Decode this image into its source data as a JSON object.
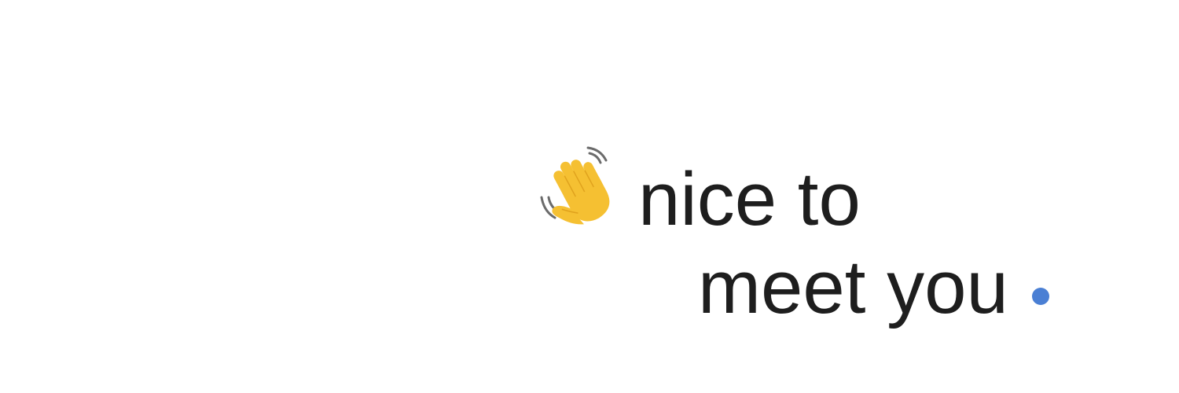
{
  "greeting": {
    "icon": "waving-hand-icon",
    "line1": "nice to",
    "line2": "meet you"
  },
  "colors": {
    "text": "#1e1e1e",
    "accent": "#4a7fd4",
    "hand": "#f5c032",
    "hand_shadow": "#e0a21d",
    "motion_lines": "#6b6b6b"
  }
}
